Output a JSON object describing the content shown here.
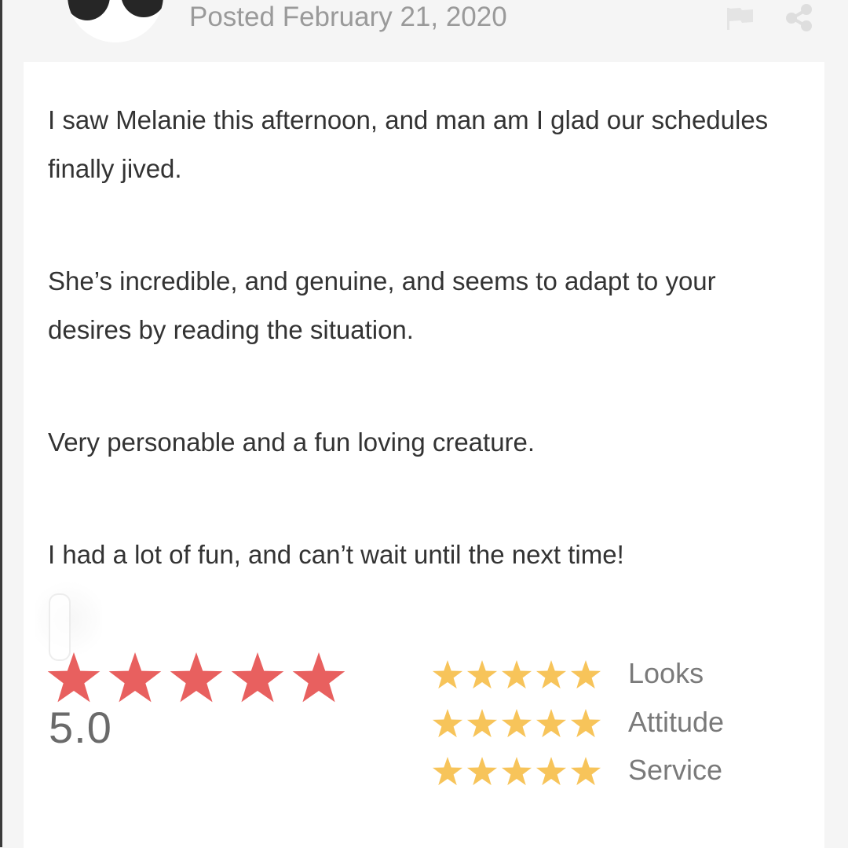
{
  "review": {
    "posted_label": "Posted February 21, 2020",
    "paragraphs": [
      "I saw Melanie this afternoon, and man am I glad our schedules finally jived.",
      "She’s incredible, and genuine, and seems to adapt to your desires by reading the situation.",
      "Very personable and a fun loving creature.",
      "I had a lot of fun, and can’t wait until the next time!"
    ]
  },
  "rating": {
    "overall_text": "5.0",
    "overall_stars": 5,
    "overall_color": "#e8605f",
    "category_color": "#f7c45a",
    "categories": [
      {
        "label": "Looks",
        "stars": 5
      },
      {
        "label": "Attitude",
        "stars": 5
      },
      {
        "label": "Service",
        "stars": 5
      }
    ]
  },
  "icons": {
    "flag": "flag-icon",
    "share": "share-icon",
    "avatar": "avatar"
  }
}
